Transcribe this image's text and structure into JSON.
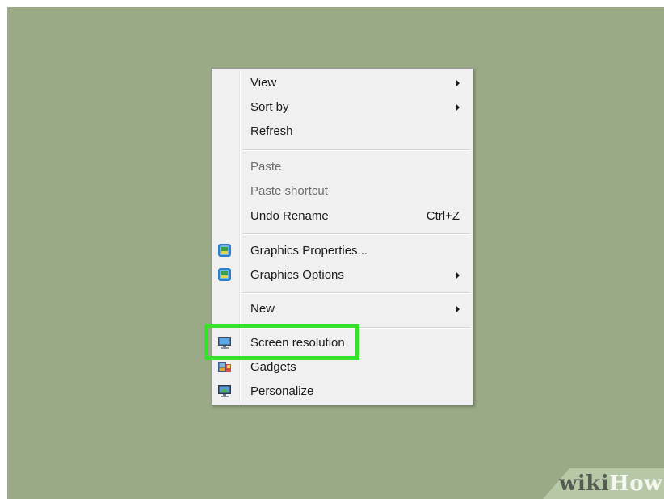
{
  "menu": {
    "items": [
      {
        "label": "View",
        "submenu": true
      },
      {
        "label": "Sort by",
        "submenu": true
      },
      {
        "label": "Refresh"
      },
      {
        "label": "Paste",
        "disabled": true
      },
      {
        "label": "Paste shortcut",
        "disabled": true
      },
      {
        "label": "Undo Rename",
        "shortcut": "Ctrl+Z"
      },
      {
        "label": "Graphics Properties...",
        "icon": "intel-graphics-icon"
      },
      {
        "label": "Graphics Options",
        "icon": "intel-graphics-icon",
        "submenu": true
      },
      {
        "label": "New",
        "submenu": true
      },
      {
        "label": "Screen resolution",
        "icon": "monitor-icon",
        "highlighted": true
      },
      {
        "label": "Gadgets",
        "icon": "gadgets-icon"
      },
      {
        "label": "Personalize",
        "icon": "personalize-icon"
      }
    ]
  },
  "highlight_color": "#37e02a",
  "watermark": {
    "wiki": "wiki",
    "how": "How"
  }
}
